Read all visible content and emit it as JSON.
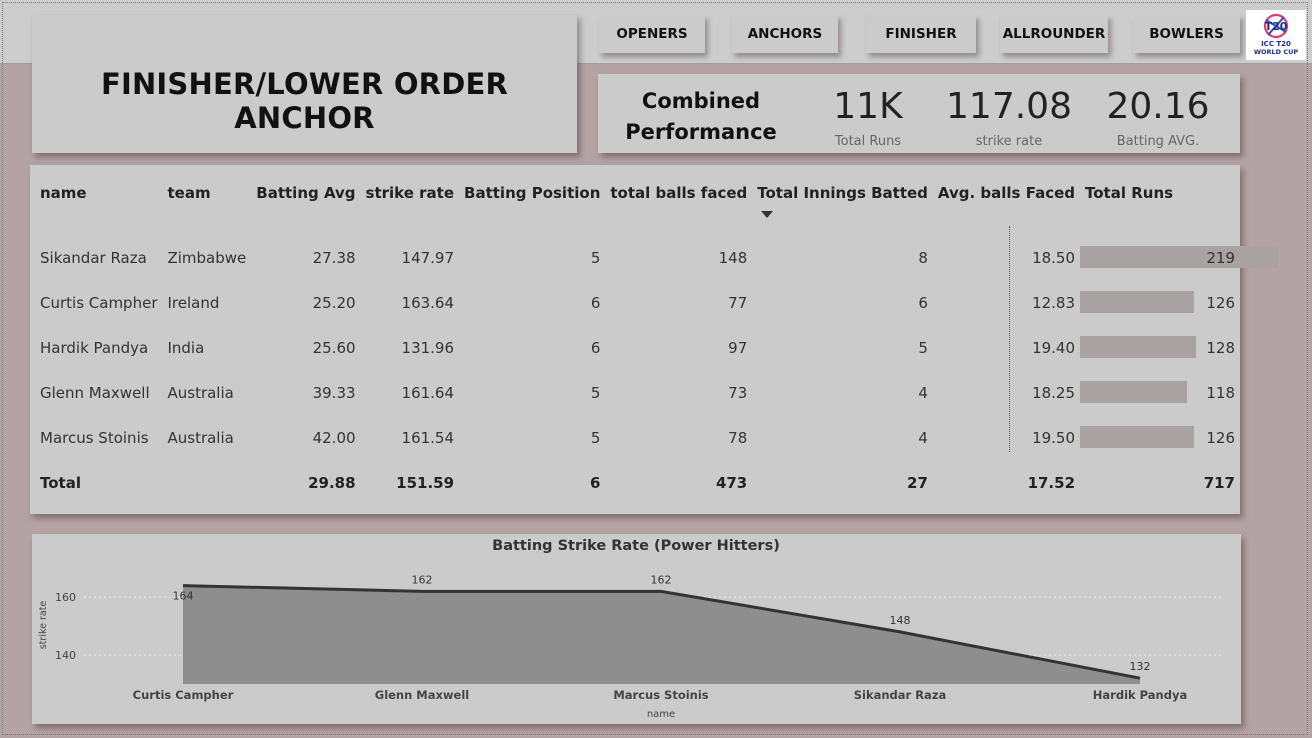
{
  "page_title": "FINISHER/LOWER ORDER ANCHOR",
  "nav": [
    {
      "label": "OPENERS"
    },
    {
      "label": "ANCHORS"
    },
    {
      "label": "FINISHER"
    },
    {
      "label": "ALLROUNDER"
    },
    {
      "label": "BOWLERS"
    }
  ],
  "logo": {
    "line1": "T20",
    "line2": "ICC T20",
    "line3": "WORLD CUP"
  },
  "kpi": {
    "heading_line1": "Combined",
    "heading_line2": "Performance",
    "cards": [
      {
        "value": "11K",
        "label": "Total Runs"
      },
      {
        "value": "117.08",
        "label": "strike rate"
      },
      {
        "value": "20.16",
        "label": "Batting AVG."
      }
    ]
  },
  "table": {
    "columns": [
      "name",
      "team",
      "Batting Avg",
      "strike rate",
      "Batting Position",
      "total balls faced",
      "Total Innings Batted",
      "Avg. balls Faced",
      "Total Runs"
    ],
    "sorted_column": "Total Innings Batted",
    "runs_max": 219,
    "rows": [
      {
        "name": "Sikandar Raza",
        "team": "Zimbabwe",
        "avg": "27.38",
        "sr": "147.97",
        "pos": "5",
        "balls": "148",
        "innings": "8",
        "avg_balls": "18.50",
        "runs": "219",
        "runs_num": 219
      },
      {
        "name": "Curtis Campher",
        "team": "Ireland",
        "avg": "25.20",
        "sr": "163.64",
        "pos": "6",
        "balls": "77",
        "innings": "6",
        "avg_balls": "12.83",
        "runs": "126",
        "runs_num": 126
      },
      {
        "name": "Hardik Pandya",
        "team": "India",
        "avg": "25.60",
        "sr": "131.96",
        "pos": "6",
        "balls": "97",
        "innings": "5",
        "avg_balls": "19.40",
        "runs": "128",
        "runs_num": 128
      },
      {
        "name": "Glenn Maxwell",
        "team": "Australia",
        "avg": "39.33",
        "sr": "161.64",
        "pos": "5",
        "balls": "73",
        "innings": "4",
        "avg_balls": "18.25",
        "runs": "118",
        "runs_num": 118
      },
      {
        "name": "Marcus Stoinis",
        "team": "Australia",
        "avg": "42.00",
        "sr": "161.54",
        "pos": "5",
        "balls": "78",
        "innings": "4",
        "avg_balls": "19.50",
        "runs": "126",
        "runs_num": 126
      }
    ],
    "total": {
      "label": "Total",
      "avg": "29.88",
      "sr": "151.59",
      "pos": "6",
      "balls": "473",
      "innings": "27",
      "avg_balls": "17.52",
      "runs": "717"
    }
  },
  "chart_data": {
    "type": "area",
    "title": "Batting Strike Rate (Power Hitters)",
    "xlabel": "name",
    "ylabel": "strike rate",
    "categories": [
      "Curtis Campher",
      "Glenn Maxwell",
      "Marcus Stoinis",
      "Sikandar Raza",
      "Hardik Pandya"
    ],
    "values": [
      164,
      162,
      162,
      148,
      132
    ],
    "data_labels": [
      "164",
      "162",
      "162",
      "148",
      "132"
    ],
    "yticks": [
      140,
      160
    ],
    "ylim": [
      130,
      168
    ],
    "grid": true,
    "colors": {
      "fill": "#8e8e8e",
      "line": "#333333"
    }
  }
}
